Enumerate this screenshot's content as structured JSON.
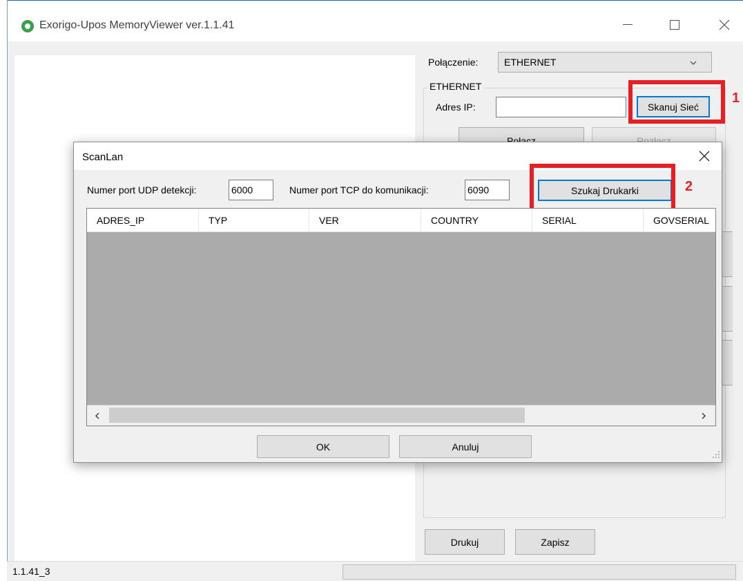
{
  "app": {
    "title": "Exorigo-Upos MemoryViewer ver.1.1.41",
    "icon": "exorigo-app-icon"
  },
  "connection": {
    "label": "Połączenie:",
    "selected": "ETHERNET",
    "group_label": "ETHERNET",
    "ip_label": "Adres IP:",
    "ip_value": "",
    "scan_button": "Skanuj Sieć",
    "connect_button": "Połącz",
    "disconnect_button": "Rozłącz"
  },
  "bottom_buttons": {
    "print": "Drukuj",
    "save": "Zapisz"
  },
  "status": {
    "version": "1.1.41_3"
  },
  "dialog": {
    "title": "ScanLan",
    "udp_label": "Numer port UDP detekcji:",
    "udp_value": "6000",
    "tcp_label": "Numer port TCP do komunikacji:",
    "tcp_value": "6090",
    "search_button": "Szukaj Drukarki",
    "columns": [
      "ADRES_IP",
      "TYP",
      "VER",
      "COUNTRY",
      "SERIAL",
      "GOVSERIAL"
    ],
    "ok": "OK",
    "cancel": "Anuluj"
  },
  "annotations": {
    "step1": "1",
    "step2": "2"
  },
  "colors": {
    "highlight": "#e51f24",
    "focus": "#0078d7",
    "app_icon": "#3aa14a"
  }
}
